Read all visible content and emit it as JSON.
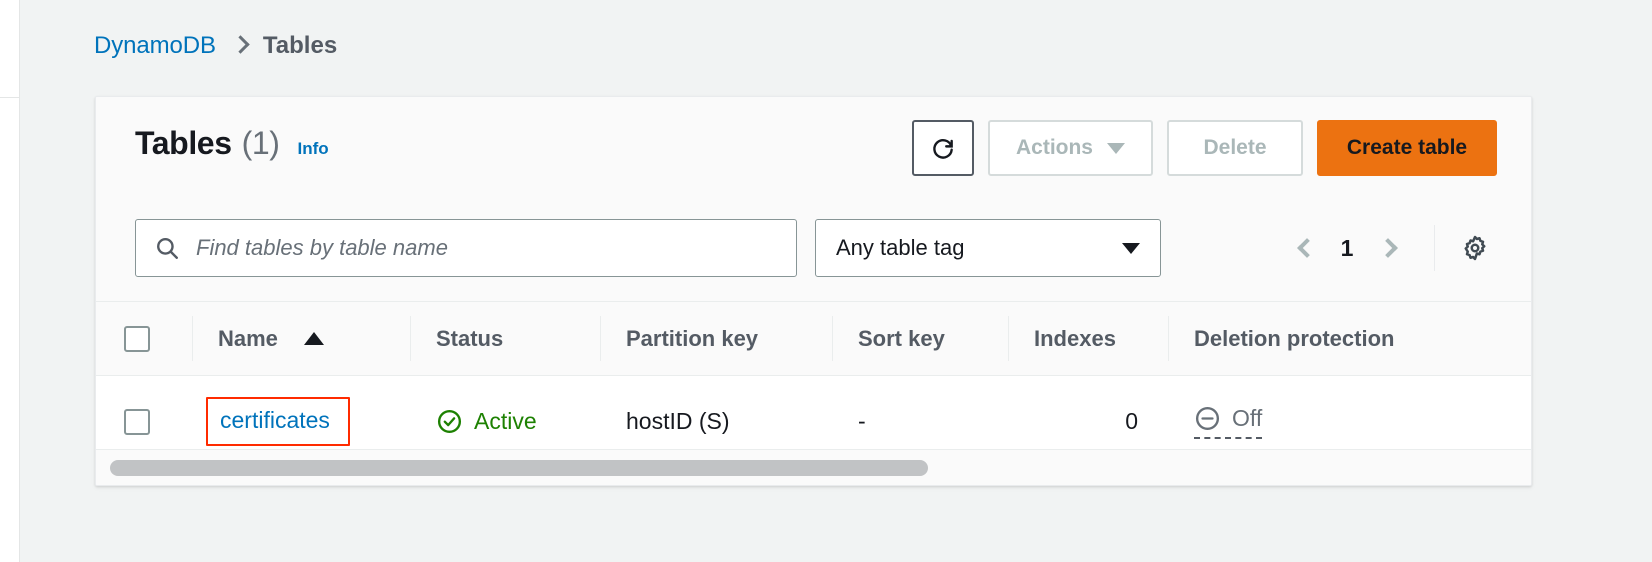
{
  "breadcrumb": {
    "root": "DynamoDB",
    "separator_icon": "chevron-right-icon",
    "current": "Tables"
  },
  "panel": {
    "title": "Tables",
    "count": "(1)",
    "info_label": "Info"
  },
  "toolbar": {
    "refresh_icon": "refresh-icon",
    "actions_label": "Actions",
    "actions_caret_icon": "caret-down-icon",
    "delete_label": "Delete",
    "create_label": "Create table"
  },
  "filters": {
    "search_icon": "search-icon",
    "search_value": "",
    "search_placeholder": "Find tables by table name",
    "tag_filter_label": "Any table tag",
    "tag_filter_caret_icon": "caret-down-icon",
    "pagination": {
      "prev_icon": "chevron-left-icon",
      "page": "1",
      "next_icon": "chevron-right-icon"
    },
    "settings_icon": "gear-icon"
  },
  "table": {
    "select_all_checkbox": "unchecked",
    "sort_icon": "sort-ascending-icon",
    "columns": [
      "Name",
      "Status",
      "Partition key",
      "Sort key",
      "Indexes",
      "Deletion protection"
    ],
    "rows": [
      {
        "checkbox": "unchecked",
        "name": "certificates",
        "status": "Active",
        "status_icon": "check-circle-icon",
        "partition_key": "hostID (S)",
        "sort_key": "-",
        "indexes": "0",
        "deletion_protection": "Off",
        "deletion_protection_icon": "minus-circle-icon"
      }
    ],
    "scrollbar": "horizontal-scrollbar"
  },
  "colors": {
    "link": "#0073bb",
    "primary_button": "#ec7211",
    "status_active": "#1d8102",
    "highlight_box": "#ff2b00",
    "page_background": "#f1f3f3"
  }
}
